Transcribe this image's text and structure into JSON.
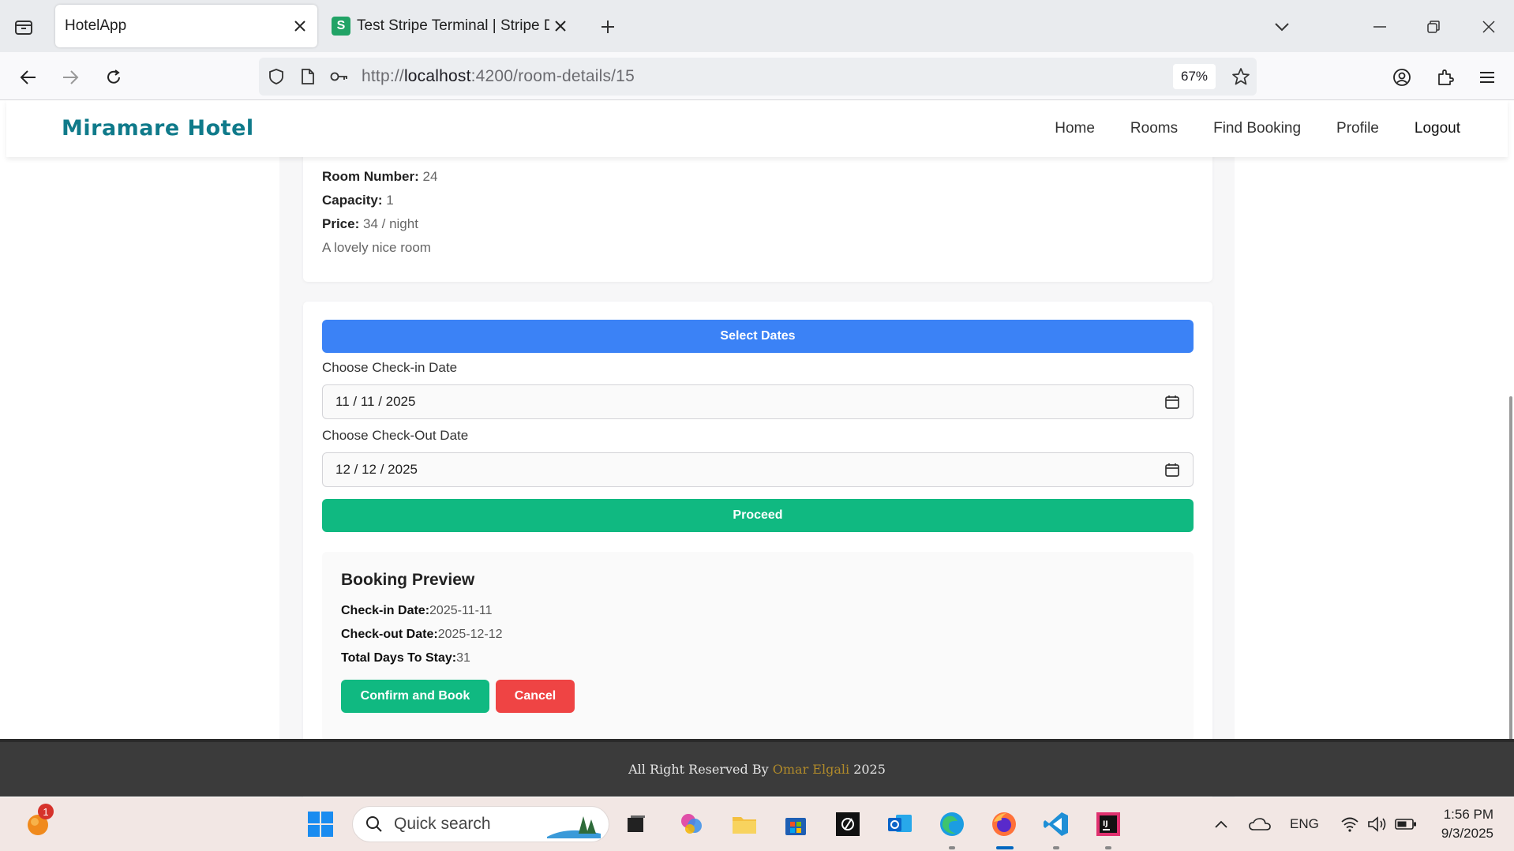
{
  "browser": {
    "tabs": [
      {
        "title": "HotelApp"
      },
      {
        "title": "Test Stripe Terminal | Stripe Docs",
        "favicon": "S"
      }
    ],
    "url": {
      "prefix": "http://",
      "host": "localhost",
      "path": ":4200/room-details/15"
    },
    "zoom": "67%"
  },
  "site": {
    "brand": "Miramare Hotel",
    "nav": [
      "Home",
      "Rooms",
      "Find Booking",
      "Profile",
      "Logout"
    ]
  },
  "room": {
    "number_label": "Room Number:",
    "number": "24",
    "capacity_label": "Capacity:",
    "capacity": "1",
    "price_label": "Price:",
    "price": "34 / night",
    "description": "A lovely nice room"
  },
  "booking": {
    "select_dates": "Select Dates",
    "checkin_label": "Choose Check-in Date",
    "checkin_value": "11 / 11 / 2025",
    "checkout_label": "Choose Check-Out Date",
    "checkout_value": "12 / 12 / 2025",
    "proceed": "Proceed"
  },
  "preview": {
    "title": "Booking Preview",
    "checkin_label": "Check-in Date:",
    "checkin": "2025-11-11",
    "checkout_label": "Check-out Date:",
    "checkout": "2025-12-12",
    "days_label": "Total Days To Stay:",
    "days": "31",
    "confirm": "Confirm and Book",
    "cancel": "Cancel"
  },
  "footer": {
    "prefix": "All Right Reserved By ",
    "name": "Omar Elgali",
    "suffix": " 2025"
  },
  "taskbar": {
    "search_placeholder": "Quick search",
    "notification_count": "1",
    "language": "ENG",
    "time": "1:56 PM",
    "date": "9/3/2025"
  },
  "colors": {
    "brand": "#0f7a8a",
    "select_dates_button": "#3b82f6",
    "proceed_button": "#10b981",
    "confirm_button": "#10b981",
    "cancel_button": "#ef4444",
    "footer_bg": "#3b3b3b"
  }
}
